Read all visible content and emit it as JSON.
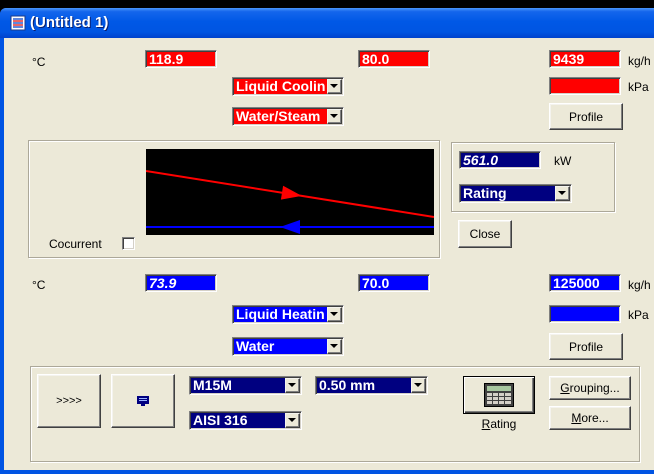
{
  "window": {
    "title": "(Untitled 1)"
  },
  "colors": {
    "hot": "#ff0000",
    "cold": "#0000ff",
    "selection": "#000080"
  },
  "hot_side": {
    "temp_unit": "°C",
    "inlet_temp": "118.9",
    "outlet_temp": "80.0",
    "flow": "9439",
    "flow_unit": "kg/h",
    "pressure": "",
    "pressure_unit": "kPa",
    "duty": "Liquid Coolin",
    "fluid": "Water/Steam",
    "profile_button": "Profile"
  },
  "diagram": {
    "cocurrent_label": "Cocurrent",
    "cocurrent_checked": false
  },
  "result": {
    "heat_load": "561.0",
    "heat_load_unit": "kW",
    "calculation_mode": "Rating",
    "close_button": "Close"
  },
  "cold_side": {
    "temp_unit": "°C",
    "outlet_temp": "73.9",
    "inlet_temp": "70.0",
    "flow": "125000",
    "flow_unit": "kg/h",
    "pressure": "",
    "pressure_unit": "kPa",
    "duty": "Liquid Heatin",
    "fluid": "Water",
    "profile_button": "Profile"
  },
  "equipment": {
    "expand_button": ">>>>",
    "plate_type": "M15M",
    "plate_thickness": "0.50 mm",
    "plate_material": "AISI 316",
    "calculate_label": "Rating",
    "grouping_button": "Grouping...",
    "more_button": "More..."
  },
  "icons": {
    "app": "app-icon",
    "list": "list-icon",
    "calculator": "calculator-icon",
    "dropdown_arrow": "chevron-down-icon",
    "hot_flow_direction": "arrow-right-icon",
    "cold_flow_direction": "arrow-left-icon"
  }
}
